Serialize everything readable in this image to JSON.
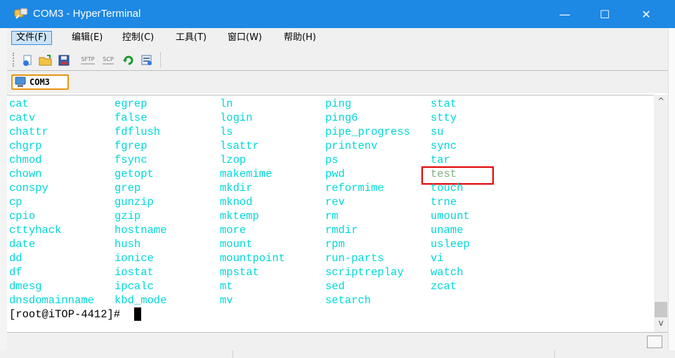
{
  "window": {
    "title": "COM3 - HyperTerminal",
    "controls": {
      "minimize": "—",
      "maximize": "☐",
      "close": "✕"
    }
  },
  "menubar": {
    "items": [
      {
        "label": "文件(F)",
        "active": true
      },
      {
        "label": "编辑(E)"
      },
      {
        "label": "控制(C)"
      },
      {
        "label": "工具(T)"
      },
      {
        "label": "窗口(W)"
      },
      {
        "label": "帮助(H)"
      }
    ]
  },
  "toolbar": {
    "sftp_label": "SFTP",
    "scp_label": "SCP",
    "icons": [
      "new-session-icon",
      "open-folder-icon",
      "save-icon",
      "sftp-icon",
      "scp-icon",
      "refresh-icon",
      "properties-icon"
    ]
  },
  "tab": {
    "label": "COM3"
  },
  "terminal": {
    "columns": [
      [
        "cat",
        "catv",
        "chattr",
        "chgrp",
        "chmod",
        "chown",
        "conspy",
        "cp",
        "cpio",
        "cttyhack",
        "date",
        "dd",
        "df",
        "dmesg",
        "dnsdomainname"
      ],
      [
        "egrep",
        "false",
        "fdflush",
        "fgrep",
        "fsync",
        "getopt",
        "grep",
        "gunzip",
        "gzip",
        "hostname",
        "hush",
        "ionice",
        "iostat",
        "ipcalc",
        "kbd_mode"
      ],
      [
        "ln",
        "login",
        "ls",
        "lsattr",
        "lzop",
        "makemime",
        "mkdir",
        "mknod",
        "mktemp",
        "more",
        "mount",
        "mountpoint",
        "mpstat",
        "mt",
        "mv"
      ],
      [
        "ping",
        "ping6",
        "pipe_progress",
        "printenv",
        "ps",
        "pwd",
        "reformime",
        "rev",
        "rm",
        "rmdir",
        "rpm",
        "run-parts",
        "scriptreplay",
        "sed",
        "setarch"
      ],
      [
        "stat",
        "stty",
        "su",
        "sync",
        "tar",
        "test",
        "touch",
        "trne",
        "umount",
        "uname",
        "usleep",
        "vi",
        "watch",
        "zcat"
      ]
    ],
    "highlighted_entry": "test",
    "prompt": "[root@iTOP-4412]# "
  },
  "colors": {
    "titlebar": "#1e88e5",
    "terminal_text": "#00d8d8",
    "highlight_text": "#7fb07f",
    "highlight_box": "#e00000",
    "tab_border": "#e89510"
  }
}
